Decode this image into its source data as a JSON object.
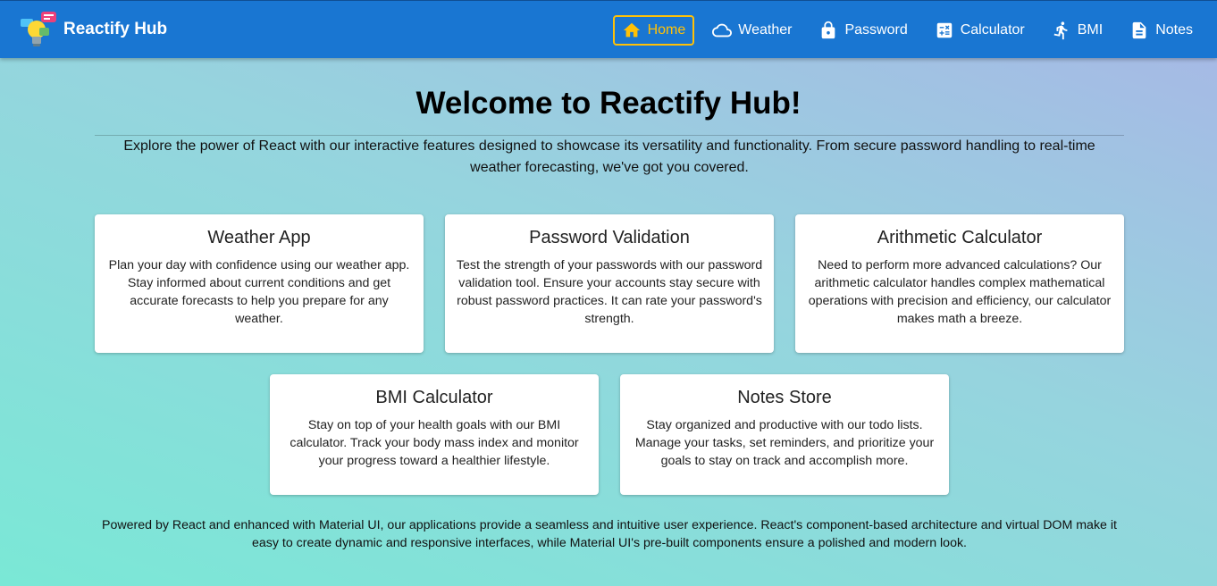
{
  "app": {
    "title": "Reactify Hub"
  },
  "nav": {
    "items": [
      {
        "label": "Home",
        "icon": "home-icon",
        "active": true
      },
      {
        "label": "Weather",
        "icon": "cloud-icon",
        "active": false
      },
      {
        "label": "Password",
        "icon": "lock-icon",
        "active": false
      },
      {
        "label": "Calculator",
        "icon": "calculator-icon",
        "active": false
      },
      {
        "label": "BMI",
        "icon": "running-icon",
        "active": false
      },
      {
        "label": "Notes",
        "icon": "document-icon",
        "active": false
      }
    ]
  },
  "hero": {
    "title": "Welcome to Reactify Hub!",
    "intro": "Explore the power of React with our interactive features designed to showcase its versatility and functionality. From secure password handling to real-time weather forecasting, we've got you covered."
  },
  "cards": [
    {
      "title": "Weather App",
      "text": "Plan your day with confidence using our weather app. Stay informed about current conditions and get accurate forecasts to help you prepare for any weather."
    },
    {
      "title": "Password Validation",
      "text": "Test the strength of your passwords with our password validation tool. Ensure your accounts stay secure with robust password practices. It can rate your password's strength."
    },
    {
      "title": "Arithmetic Calculator",
      "text": "Need to perform more advanced calculations? Our arithmetic calculator handles complex mathematical operations with precision and efficiency, our calculator makes math a breeze."
    },
    {
      "title": "BMI Calculator",
      "text": "Stay on top of your health goals with our BMI calculator. Track your body mass index and monitor your progress toward a healthier lifestyle."
    },
    {
      "title": "Notes Store",
      "text": "Stay organized and productive with our todo lists. Manage your tasks, set reminders, and prioritize your goals to stay on track and accomplish more."
    }
  ],
  "footer": {
    "text": "Powered by React and enhanced with Material UI, our applications provide a seamless and intuitive user experience. React's component-based architecture and virtual DOM make it easy to create dynamic and responsive interfaces, while Material UI's pre-built components ensure a polished and modern look."
  },
  "colors": {
    "appbar": "#1976d2",
    "active_nav": "#ffc107",
    "card_bg": "#ffffff"
  }
}
